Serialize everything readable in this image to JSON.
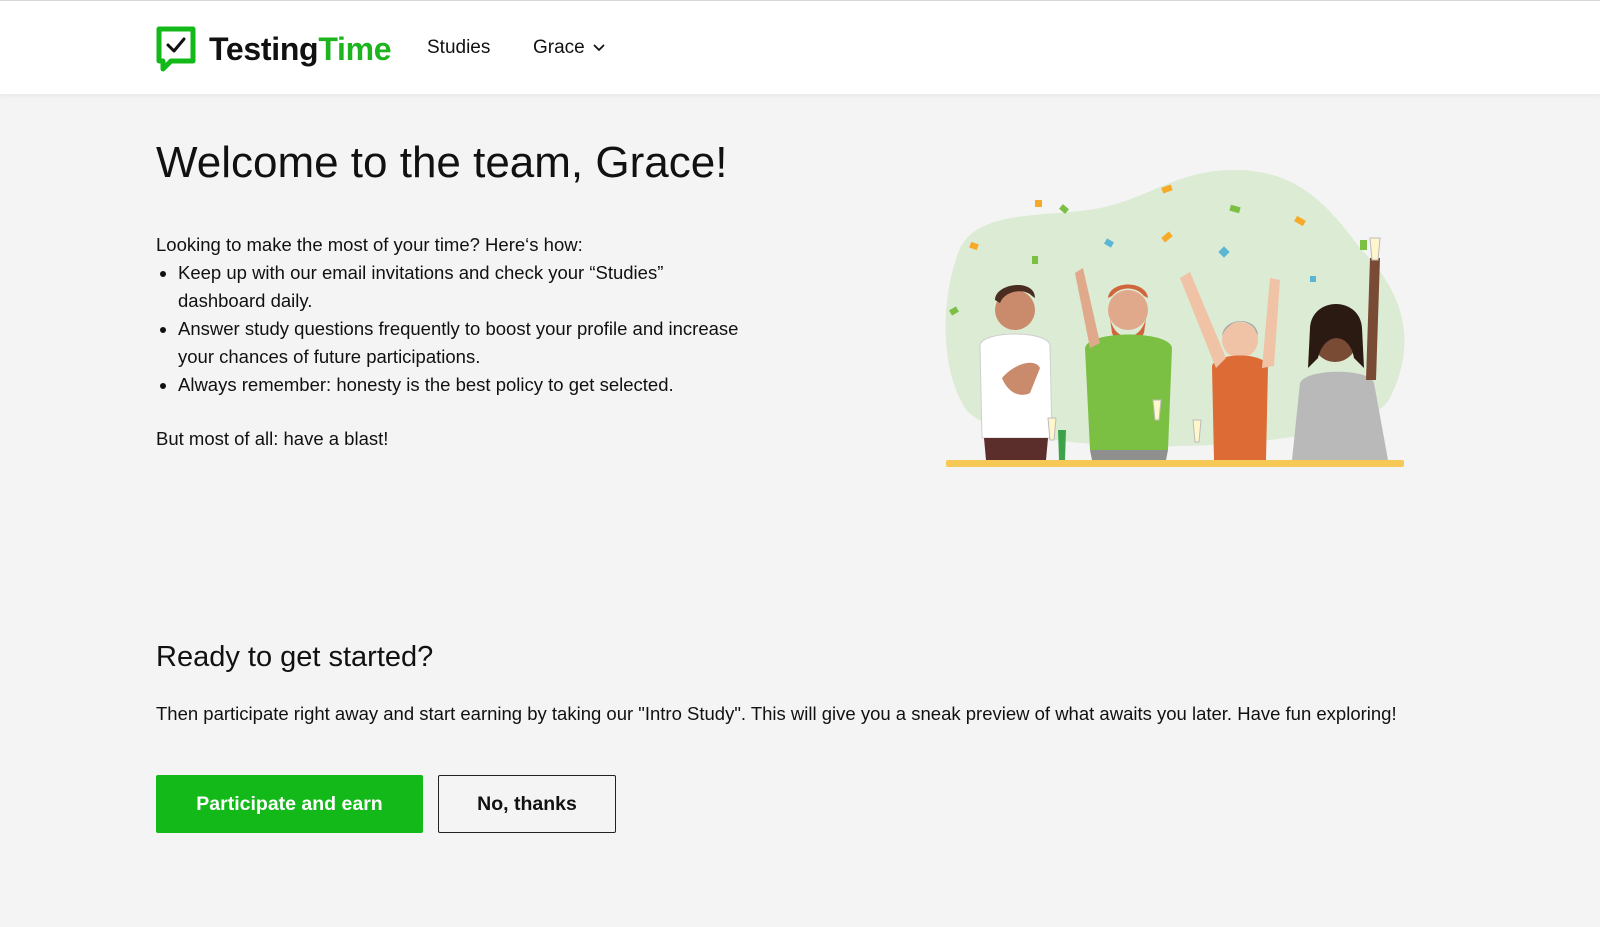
{
  "brand": {
    "name_part1": "Testing",
    "name_part2": "Time",
    "accent_color": "#13b919"
  },
  "nav": {
    "studies_label": "Studies",
    "user_label": "Grace",
    "user_icon": "chevron-down-icon"
  },
  "welcome": {
    "title": "Welcome to the team, Grace!",
    "lead": "Looking to make the most of your time? Here‘s how:",
    "tips": [
      "Keep up with our email invitations and check your “Studies” dashboard daily.",
      "Answer study questions frequently to boost your profile and increase your chances of future participations.",
      "Always remember: honesty is the best policy to get selected."
    ],
    "closing": "But most of all: have a blast!"
  },
  "illustration": {
    "icon": "celebrating-team-illustration"
  },
  "ready": {
    "title": "Ready to get started?",
    "text": "Then participate right away and start earning by taking our \"Intro Study\". This will give you a sneak preview of what awaits you later. Have fun exploring!",
    "primary_button": "Participate and earn",
    "secondary_button": "No, thanks"
  }
}
